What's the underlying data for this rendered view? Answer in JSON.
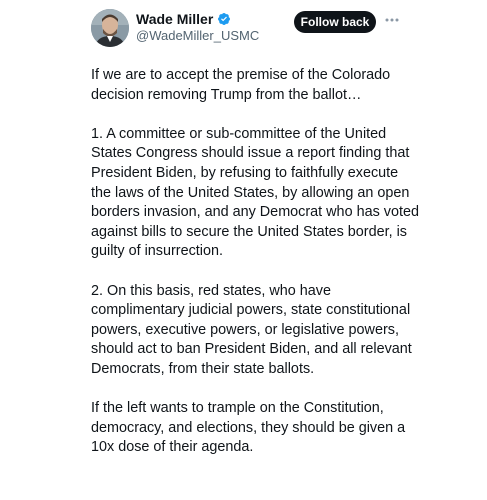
{
  "tweet": {
    "author": {
      "display_name": "Wade Miller",
      "handle": "@WadeMiller_USMC",
      "verified": true,
      "avatar_icon": "user-avatar-photo"
    },
    "follow_button_label": "Follow back",
    "more_icon": "more-dots-icon",
    "paragraphs": [
      "If we are to accept the premise of the Colorado decision removing Trump from the ballot…",
      "1. A committee or sub-committee of the United States Congress should issue a report finding that President Biden, by refusing to faithfully execute the laws of the United States, by allowing an open borders invasion, and any Democrat who has voted against bills to secure the United States border, is guilty of insurrection.",
      "2. On this basis, red states, who have complimentary judicial powers, state constitutional powers, executive powers, or legislative powers, should act to ban President Biden, and all relevant Democrats, from their state ballots.",
      "If the left wants to trample on the Constitution, democracy, and elections, they should be given a 10x dose of their agenda."
    ]
  },
  "colors": {
    "text": "#0f1419",
    "secondary_text": "#536471",
    "button_bg": "#0f1419",
    "verified_blue": "#1d9bf0"
  }
}
